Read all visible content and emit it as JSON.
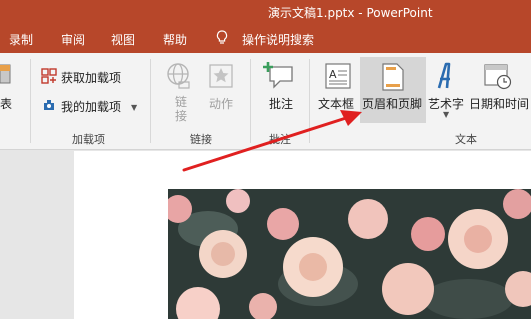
{
  "window": {
    "title": "演示文稿1.pptx  -  PowerPoint"
  },
  "menu": {
    "items": [
      "录制",
      "审阅",
      "视图",
      "帮助"
    ],
    "tell_me": "操作说明搜索"
  },
  "ribbon": {
    "partial_left_label": "表",
    "addins": {
      "get_addins": "获取加载项",
      "my_addins": "我的加载项",
      "group_label": "加载项"
    },
    "links": {
      "link": "链接",
      "action": "动作",
      "group_label": "链接"
    },
    "comments": {
      "comment": "批注",
      "group_label": "批注"
    },
    "text": {
      "textbox": "文本框",
      "header_footer": "页眉和页脚",
      "wordart": "艺术字",
      "datetime": "日期和时间",
      "group_label": "文本"
    }
  },
  "colors": {
    "accent": "#b7472a",
    "arrow": "#e02020",
    "ribbon_bg": "#f3f3f3"
  }
}
